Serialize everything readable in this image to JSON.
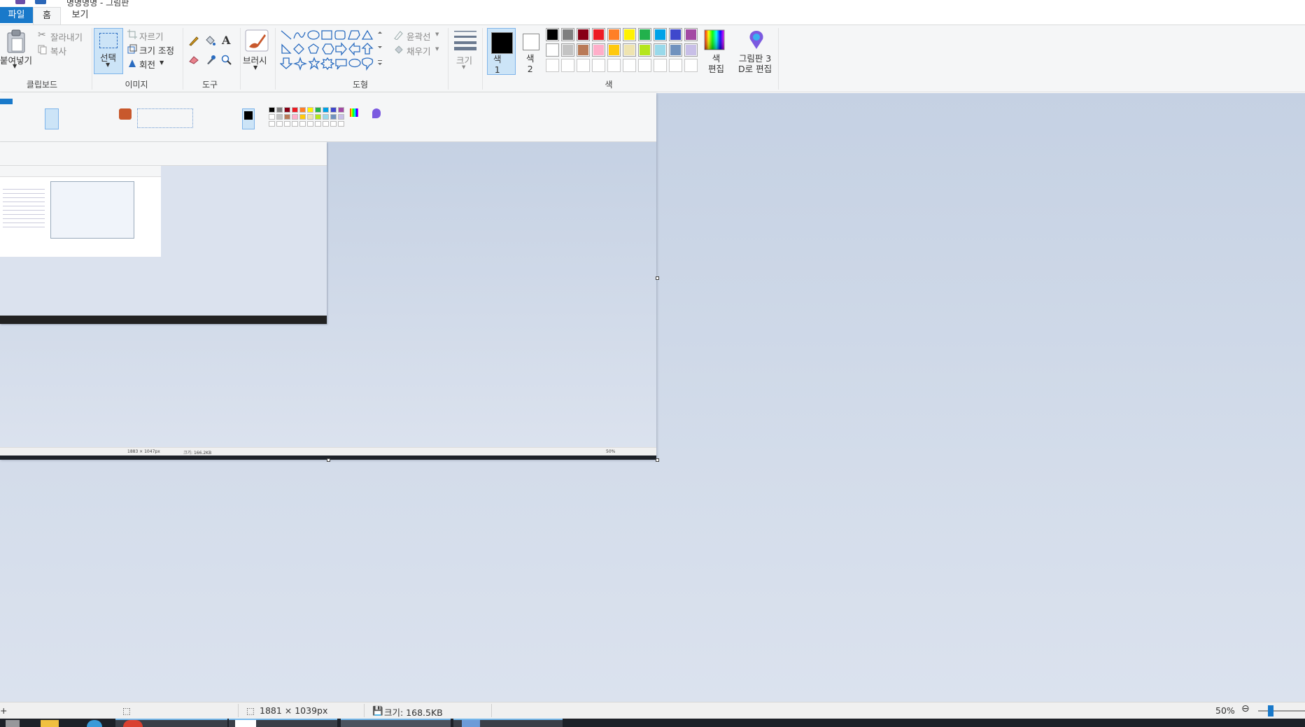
{
  "window": {
    "title": "명명명명 - 그림판"
  },
  "tabs": [
    {
      "label": "파일"
    },
    {
      "label": "홈"
    },
    {
      "label": "보기"
    }
  ],
  "ribbon": {
    "clipboard": {
      "paste": "붙여넣기",
      "cut": "잘라내기",
      "copy": "복사",
      "group": "클립보드"
    },
    "image": {
      "select": "선택",
      "crop": "자르기",
      "resize": "크기 조정",
      "rotate": "회전",
      "group": "이미지"
    },
    "tools": {
      "group": "도구",
      "text_glyph": "A"
    },
    "brushes": {
      "label": "브러시"
    },
    "shapes": {
      "outline": "윤곽선",
      "fill": "채우기",
      "group": "도형"
    },
    "size": {
      "label": "크기"
    },
    "colors": {
      "color1": "색\n1",
      "color2": "색\n2",
      "edit_colors": "색\n편집",
      "paint3d": "그림판 3\nD로 편집",
      "group": "색",
      "palette_row1": [
        "#000000",
        "#7f7f7f",
        "#880015",
        "#ed1c24",
        "#ff7f27",
        "#fff200",
        "#22b14c",
        "#00a2e8",
        "#3f48cc",
        "#a349a4"
      ],
      "palette_row2": [
        "#ffffff",
        "#c3c3c3",
        "#b97a57",
        "#ffaec9",
        "#ffc90e",
        "#efe4b0",
        "#b5e61d",
        "#99d9ea",
        "#7092be",
        "#c8bfe7"
      ]
    }
  },
  "statusbar": {
    "dimensions": "1881 × 1039px",
    "filesize": "크기: 168.5KB",
    "zoom": "50%"
  },
  "nested": {
    "statusbar": {
      "dimensions": "1883 × 1047px",
      "filesize": "크기: 166.2KB",
      "zoom": "50%"
    }
  }
}
